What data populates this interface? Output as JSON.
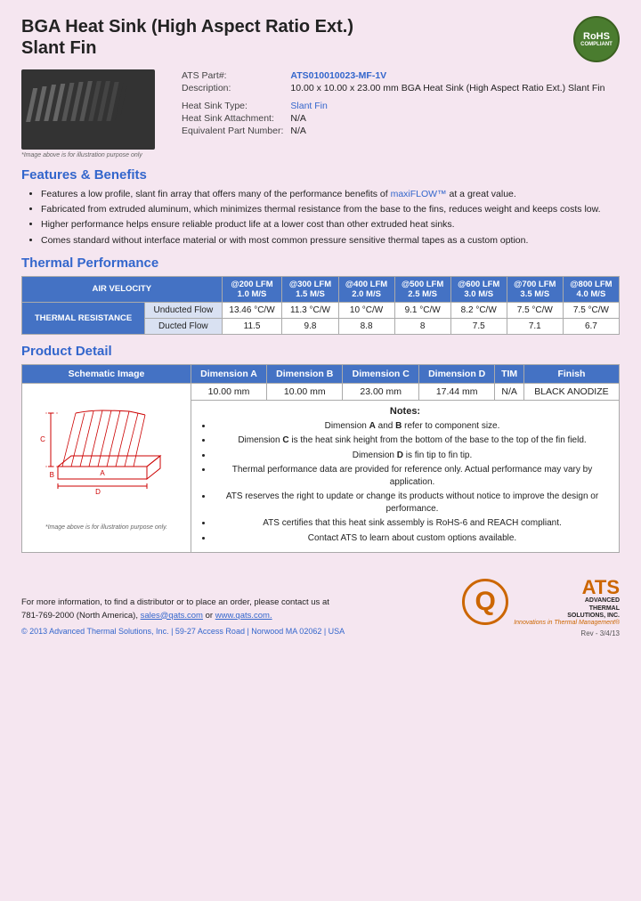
{
  "header": {
    "title_line1": "BGA Heat Sink (High Aspect Ratio Ext.)",
    "title_line2": "Slant Fin"
  },
  "specs": {
    "part_label": "ATS Part#:",
    "part_value": "ATS010010023-MF-1V",
    "description_label": "Description:",
    "description_value": "10.00 x 10.00 x 23.00 mm BGA Heat Sink (High Aspect Ratio Ext.) Slant Fin",
    "type_label": "Heat Sink Type:",
    "type_value": "Slant Fin",
    "attachment_label": "Heat Sink Attachment:",
    "attachment_value": "N/A",
    "equiv_label": "Equivalent Part Number:",
    "equiv_value": "N/A"
  },
  "image_caption": "*Image above is for illustration purpose only",
  "features": {
    "section_title": "Features & Benefits",
    "items": [
      "Features a low profile, slant fin array that offers many of the performance benefits of maxiFLOW™ at a great value.",
      "Fabricated from extruded aluminum, which minimizes thermal resistance from the base to the fins, reduces weight and keeps costs low.",
      "Higher performance helps ensure reliable product life at a lower cost than other extruded heat sinks.",
      "Comes standard without interface material or with most common pressure sensitive thermal tapes as a custom option."
    ],
    "maxiflow_link": "maxiFLOW™"
  },
  "thermal": {
    "section_title": "Thermal Performance",
    "col_headers": [
      "AIR VELOCITY",
      "@200 LFM 1.0 M/S",
      "@300 LFM 1.5 M/S",
      "@400 LFM 2.0 M/S",
      "@500 LFM 2.5 M/S",
      "@600 LFM 3.0 M/S",
      "@700 LFM 3.5 M/S",
      "@800 LFM 4.0 M/S"
    ],
    "row_label": "THERMAL RESISTANCE",
    "rows": [
      {
        "label": "Unducted Flow",
        "values": [
          "13.46 °C/W",
          "11.3 °C/W",
          "10 °C/W",
          "9.1 °C/W",
          "8.2 °C/W",
          "7.5 °C/W",
          "7.5 °C/W"
        ]
      },
      {
        "label": "Ducted Flow",
        "values": [
          "11.5",
          "9.8",
          "8.8",
          "8",
          "7.5",
          "7.1",
          "6.7"
        ]
      }
    ]
  },
  "product_detail": {
    "section_title": "Product Detail",
    "col_headers": [
      "Schematic Image",
      "Dimension A",
      "Dimension B",
      "Dimension C",
      "Dimension D",
      "TIM",
      "Finish"
    ],
    "values": {
      "dim_a": "10.00 mm",
      "dim_b": "10.00 mm",
      "dim_c": "23.00 mm",
      "dim_d": "17.44 mm",
      "tim": "N/A",
      "finish": "BLACK ANODIZE"
    },
    "notes_title": "Notes:",
    "notes": [
      "Dimension A and B refer to component size.",
      "Dimension C is the heat sink height from the bottom of the base to the top of the fin field.",
      "Dimension D is fin tip to fin tip.",
      "Thermal performance data are provided for reference only. Actual performance may vary by application.",
      "ATS reserves the right to update or change its products without notice to improve the design or performance.",
      "ATS certifies that this heat sink assembly is RoHS-6 and REACH compliant.",
      "Contact ATS to learn about custom options available."
    ],
    "schematic_caption": "*Image above is for illustration purpose only."
  },
  "footer": {
    "contact_text": "For more information, to find a distributor or to place an order, please contact us at",
    "phone": "781-769-2000 (North America),",
    "email": "sales@qats.com",
    "email_connector": "or",
    "website": "www.qats.com.",
    "copyright": "© 2013 Advanced Thermal Solutions, Inc. | 59-27 Access Road | Norwood MA  02062 | USA",
    "page_num": "Rev - 3/4/13"
  },
  "rohs": {
    "text1": "RoHS",
    "text2": "COMPLIANT"
  },
  "ats_logo": {
    "q": "Q",
    "letters": "ATS",
    "line1": "ADVANCED",
    "line2": "THERMAL",
    "line3": "SOLUTIONS, INC.",
    "tagline": "Innovations in Thermal Management®"
  }
}
